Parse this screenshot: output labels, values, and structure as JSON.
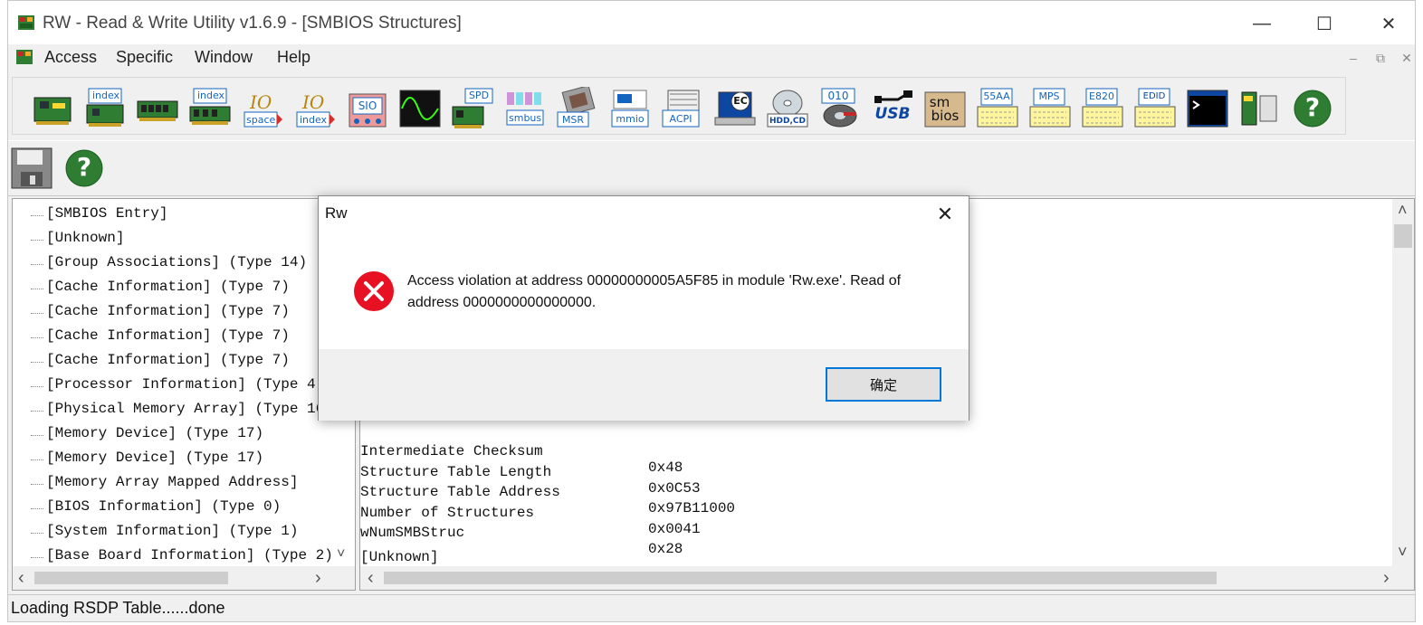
{
  "window": {
    "title": "RW - Read & Write Utility v1.6.9 - [SMBIOS Structures]",
    "minimize_glyph": "—",
    "maximize_glyph": "☐",
    "close_glyph": "✕"
  },
  "menu": {
    "items": [
      "Access",
      "Specific",
      "Window",
      "Help"
    ],
    "mdi_controls": [
      "–",
      "⧉",
      "✕"
    ]
  },
  "toolbar1": {
    "labels": {
      "index1": "index",
      "index2": "index",
      "io_space": "space",
      "io_index": "index",
      "sio": "SIO",
      "spd": "SPD",
      "smbus": "smbus",
      "msr": "MSR",
      "mmio": "mmio",
      "acpi": "ACPI",
      "ec": "EC",
      "hdd": "HDD,CD",
      "b010": "010",
      "usb": "USB",
      "sm": "sm",
      "bios": "bios",
      "b55aa": "55AA",
      "mps": "MPS",
      "e820": "E820",
      "edid": "EDID",
      "help": "?"
    }
  },
  "toolbar2": {
    "help_glyph": "?"
  },
  "tree": {
    "items": [
      "[SMBIOS Entry]",
      "[Unknown]",
      "[Group Associations] (Type 14)",
      "[Cache Information] (Type 7)",
      "[Cache Information] (Type 7)",
      "[Cache Information] (Type 7)",
      "[Cache Information] (Type 7)",
      "[Processor Information] (Type 4)",
      "[Physical Memory Array] (Type 16)",
      "[Memory Device] (Type 17)",
      "[Memory Device] (Type 17)",
      "[Memory Array Mapped Address]",
      "[BIOS Information] (Type 0)",
      "[System Information] (Type 1)",
      "[Base Board Information] (Type 2)"
    ]
  },
  "details": {
    "rows": [
      {
        "key": "Intermediate Checksum",
        "value": "0x48"
      },
      {
        "key": "Structure Table Length",
        "value": "0x0C53"
      },
      {
        "key": "Structure Table Address",
        "value": "0x97B11000"
      },
      {
        "key": "Number of Structures",
        "value": "0x0041"
      },
      {
        "key": "wNumSMBStruc",
        "value": "0x28"
      }
    ],
    "next_section": "[Unknown]"
  },
  "status": {
    "text": "Loading RSDP Table......done"
  },
  "dialog": {
    "title": "Rw",
    "message": "Access violation at address 00000000005A5F85 in module 'Rw.exe'. Read of address 0000000000000000.",
    "ok_label": "确定",
    "close_glyph": "✕"
  },
  "scroll": {
    "left": "‹",
    "right": "›",
    "up": "˄",
    "down": "˅"
  },
  "colors": {
    "accent": "#0078d7",
    "error": "#e81123",
    "window_bg": "#f0f0f0"
  }
}
